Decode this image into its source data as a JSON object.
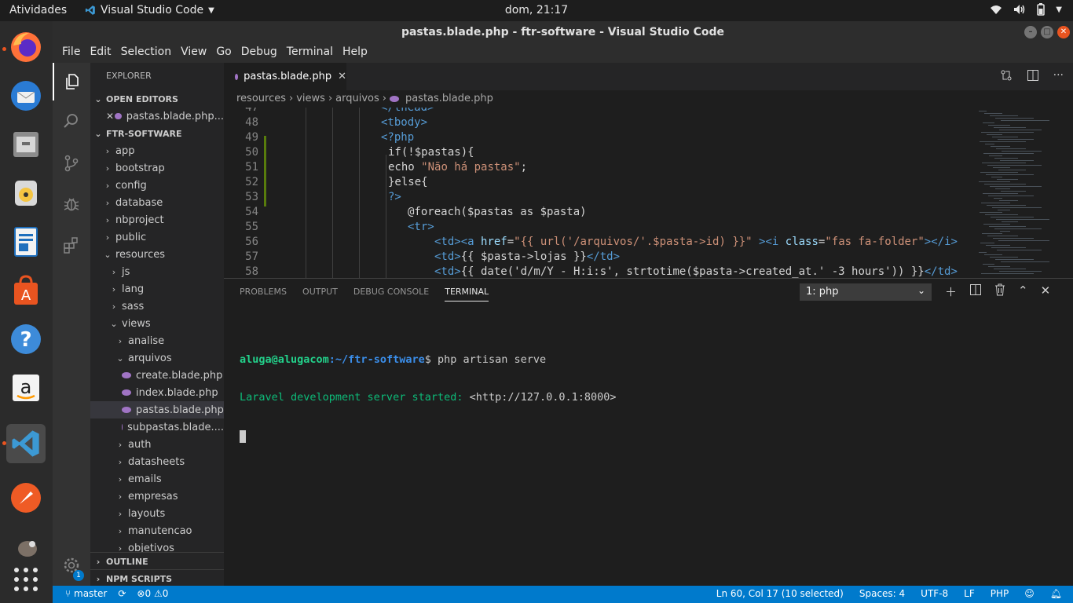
{
  "os": {
    "activities": "Atividades",
    "app_menu": "Visual Studio Code",
    "clock": "dom, 21:17"
  },
  "window": {
    "title": "pastas.blade.php - ftr-software - Visual Studio Code"
  },
  "menu": [
    "File",
    "Edit",
    "Selection",
    "View",
    "Go",
    "Debug",
    "Terminal",
    "Help"
  ],
  "sidebar": {
    "title": "EXPLORER",
    "open_editors_label": "OPEN EDITORS",
    "open_editor_file": "pastas.blade.php...",
    "project_label": "FTR-SOFTWARE",
    "tree": [
      {
        "name": "app",
        "depth": 0,
        "kind": "folder",
        "open": false
      },
      {
        "name": "bootstrap",
        "depth": 0,
        "kind": "folder",
        "open": false
      },
      {
        "name": "config",
        "depth": 0,
        "kind": "folder",
        "open": false
      },
      {
        "name": "database",
        "depth": 0,
        "kind": "folder",
        "open": false
      },
      {
        "name": "nbproject",
        "depth": 0,
        "kind": "folder",
        "open": false
      },
      {
        "name": "public",
        "depth": 0,
        "kind": "folder",
        "open": false
      },
      {
        "name": "resources",
        "depth": 0,
        "kind": "folder",
        "open": true
      },
      {
        "name": "js",
        "depth": 1,
        "kind": "folder",
        "open": false
      },
      {
        "name": "lang",
        "depth": 1,
        "kind": "folder",
        "open": false
      },
      {
        "name": "sass",
        "depth": 1,
        "kind": "folder",
        "open": false
      },
      {
        "name": "views",
        "depth": 1,
        "kind": "folder",
        "open": true
      },
      {
        "name": "analise",
        "depth": 2,
        "kind": "folder",
        "open": false
      },
      {
        "name": "arquivos",
        "depth": 2,
        "kind": "folder",
        "open": true
      },
      {
        "name": "create.blade.php",
        "depth": 3,
        "kind": "php"
      },
      {
        "name": "index.blade.php",
        "depth": 3,
        "kind": "php"
      },
      {
        "name": "pastas.blade.php",
        "depth": 3,
        "kind": "php",
        "selected": true
      },
      {
        "name": "subpastas.blade....",
        "depth": 3,
        "kind": "php"
      },
      {
        "name": "auth",
        "depth": 2,
        "kind": "folder",
        "open": false
      },
      {
        "name": "datasheets",
        "depth": 2,
        "kind": "folder",
        "open": false
      },
      {
        "name": "emails",
        "depth": 2,
        "kind": "folder",
        "open": false
      },
      {
        "name": "empresas",
        "depth": 2,
        "kind": "folder",
        "open": false
      },
      {
        "name": "layouts",
        "depth": 2,
        "kind": "folder",
        "open": false
      },
      {
        "name": "manutencao",
        "depth": 2,
        "kind": "folder",
        "open": false
      },
      {
        "name": "objetivos",
        "depth": 2,
        "kind": "folder",
        "open": false
      }
    ],
    "outline_label": "OUTLINE",
    "npm_label": "NPM SCRIPTS",
    "settings_badge": "1"
  },
  "editor": {
    "tab_label": "pastas.blade.php",
    "breadcrumb": [
      "resources",
      "views",
      "arquivos",
      "pastas.blade.php"
    ],
    "lines": [
      {
        "n": "47",
        "indent": 24,
        "tokens": [
          [
            "tag",
            "</thead>"
          ]
        ]
      },
      {
        "n": "48",
        "indent": 24,
        "tokens": [
          [
            "tag",
            "<tbody>"
          ]
        ]
      },
      {
        "n": "49",
        "indent": 24,
        "tokens": [
          [
            "tag",
            "<?php"
          ]
        ]
      },
      {
        "n": "50",
        "indent": 25,
        "tokens": [
          [
            "plain",
            "if(!$pastas){"
          ]
        ]
      },
      {
        "n": "51",
        "indent": 25,
        "tokens": [
          [
            "plain",
            "echo "
          ],
          [
            "str",
            "\"Não há pastas\""
          ],
          [
            "plain",
            ";"
          ]
        ]
      },
      {
        "n": "52",
        "indent": 25,
        "tokens": [
          [
            "plain",
            "}else{"
          ]
        ]
      },
      {
        "n": "53",
        "indent": 25,
        "tokens": [
          [
            "tag",
            "?>"
          ]
        ]
      },
      {
        "n": "54",
        "indent": 28,
        "tokens": [
          [
            "plain",
            "@foreach($pastas as $pasta)"
          ]
        ]
      },
      {
        "n": "55",
        "indent": 28,
        "tokens": [
          [
            "tag",
            "<tr>"
          ]
        ]
      },
      {
        "n": "56",
        "indent": 32,
        "tokens": [
          [
            "tag",
            "<td><a "
          ],
          [
            "attr",
            "href"
          ],
          [
            "plain",
            "="
          ],
          [
            "str",
            "\"{{ url('/arquivos/'.$pasta->id) }}\""
          ],
          [
            "tag",
            " ><i "
          ],
          [
            "attr",
            "class"
          ],
          [
            "plain",
            "="
          ],
          [
            "str",
            "\"fas fa-folder\""
          ],
          [
            "tag",
            "></i> "
          ],
          [
            "plain",
            "{"
          ]
        ]
      },
      {
        "n": "57",
        "indent": 32,
        "tokens": [
          [
            "tag",
            "<td>"
          ],
          [
            "plain",
            "{{ $pasta->lojas }}"
          ],
          [
            "tag",
            "</td>"
          ]
        ]
      },
      {
        "n": "58",
        "indent": 32,
        "tokens": [
          [
            "tag",
            "<td>"
          ],
          [
            "plain",
            "{{ date('d/m/Y - H:i:s', strtotime($pasta->created_at.' -3 hours')) }}"
          ],
          [
            "tag",
            "</td>"
          ]
        ]
      }
    ]
  },
  "panel": {
    "tabs": [
      "PROBLEMS",
      "OUTPUT",
      "DEBUG CONSOLE",
      "TERMINAL"
    ],
    "active_tab": "TERMINAL",
    "terminal_select": "1: php",
    "prompt_user": "aluga@alugacom",
    "prompt_path": ":~/ftr-software",
    "prompt_command": "$ php artisan serve",
    "output_prefix": "Laravel development server started:",
    "output_url": " <http://127.0.0.1:8000>"
  },
  "status": {
    "branch": "master",
    "errors": "0",
    "warnings": "0",
    "position": "Ln 60, Col 17 (10 selected)",
    "spaces": "Spaces: 4",
    "encoding": "UTF-8",
    "eol": "LF",
    "language": "PHP"
  },
  "colors": {
    "statusbar": "#007acc",
    "activitybar": "#333333",
    "sidebar": "#252526",
    "editor": "#1e1e1e",
    "php_icon": "#a074c4",
    "terminal_green": "#23d18b",
    "terminal_blue": "#3b8eea"
  }
}
